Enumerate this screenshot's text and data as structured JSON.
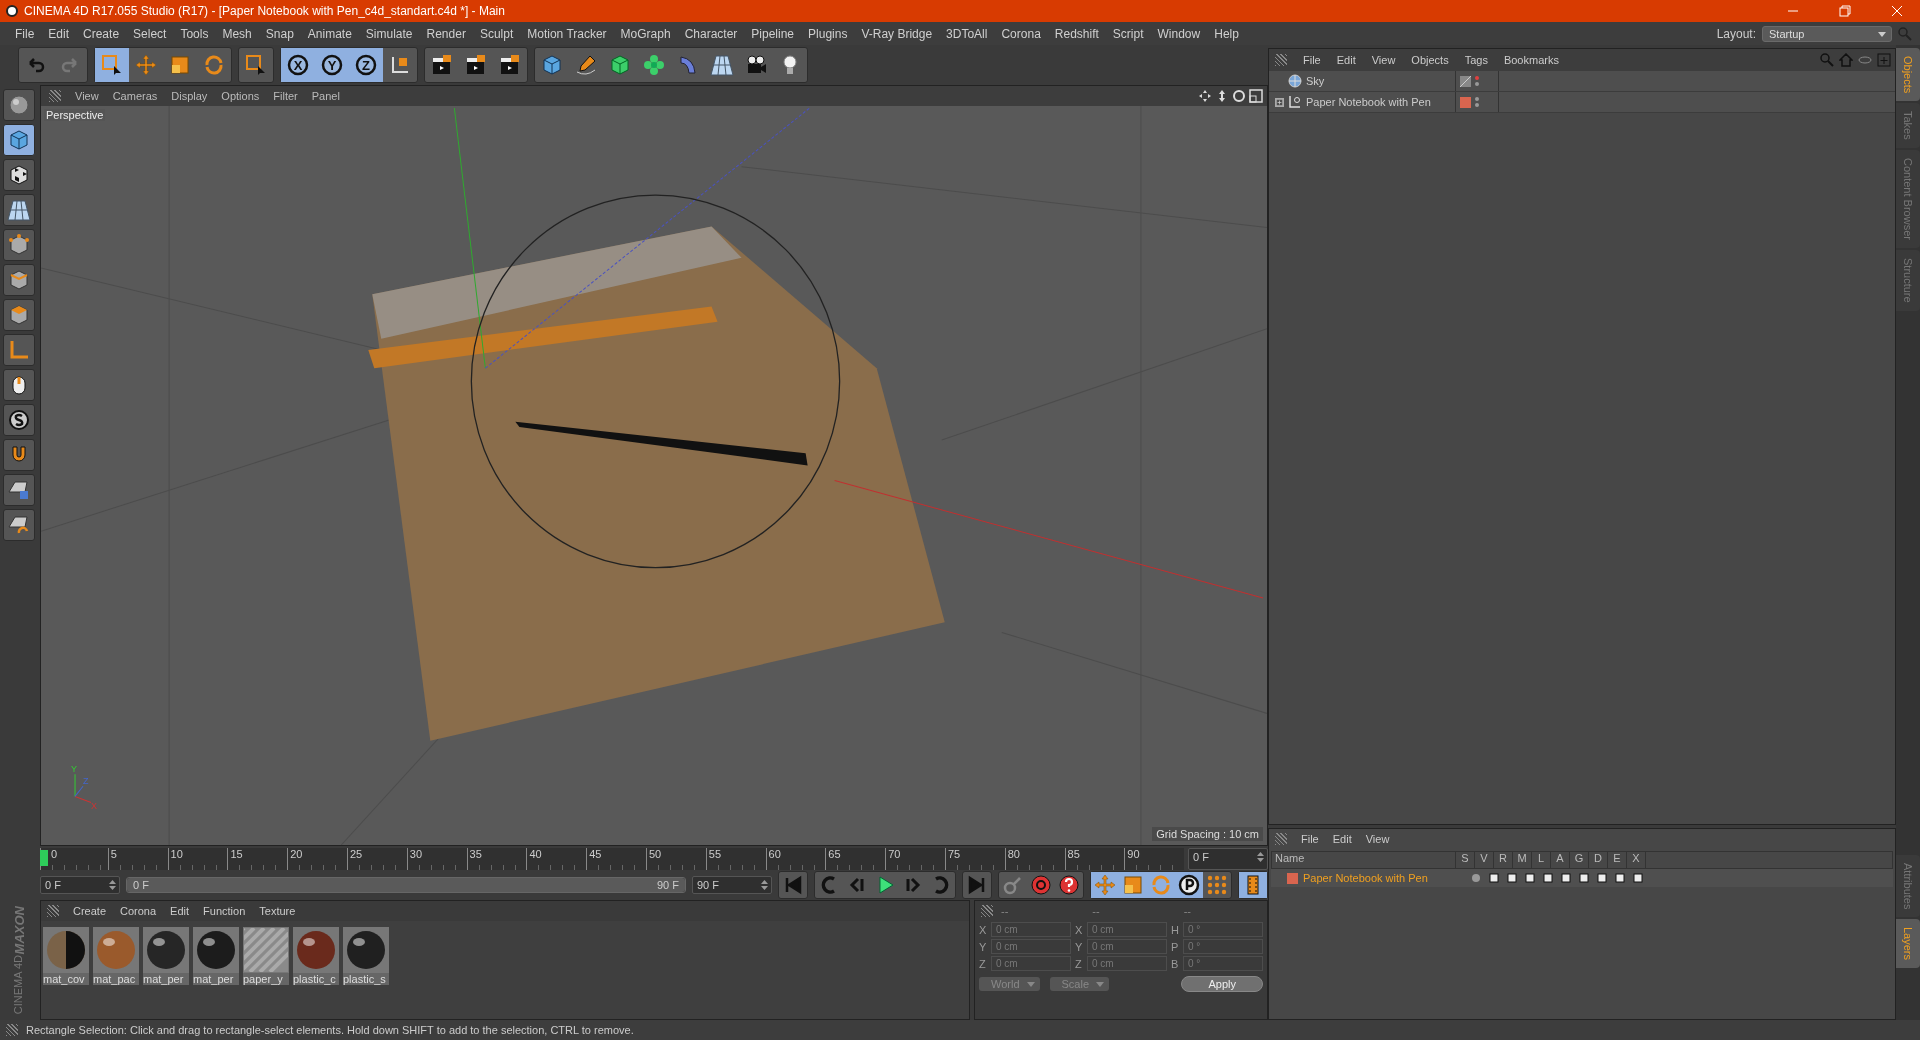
{
  "window": {
    "title": "CINEMA 4D R17.055 Studio (R17) - [Paper Notebook with Pen_c4d_standart.c4d *] - Main"
  },
  "menu": [
    "File",
    "Edit",
    "Create",
    "Select",
    "Tools",
    "Mesh",
    "Snap",
    "Animate",
    "Simulate",
    "Render",
    "Sculpt",
    "Motion Tracker",
    "MoGraph",
    "Character",
    "Pipeline",
    "Plugins",
    "V-Ray Bridge",
    "3DToAll",
    "Corona",
    "Redshift",
    "Script",
    "Window",
    "Help"
  ],
  "layout": {
    "label": "Layout:",
    "value": "Startup"
  },
  "toolbar": [
    {
      "kind": "undo",
      "selected": false
    },
    {
      "kind": "redo",
      "selected": false
    },
    {
      "kind": "select",
      "selected": true
    },
    {
      "kind": "move",
      "selected": false
    },
    {
      "kind": "scale",
      "selected": false
    },
    {
      "kind": "rotate",
      "selected": false
    },
    {
      "kind": "select",
      "selected": false
    },
    {
      "kind": "axis",
      "label": "X",
      "selected": true
    },
    {
      "kind": "axis",
      "label": "Y",
      "selected": true
    },
    {
      "kind": "axis",
      "label": "Z",
      "selected": true
    },
    {
      "kind": "coords",
      "selected": false
    },
    {
      "kind": "clapper",
      "selected": false
    },
    {
      "kind": "clapper",
      "selected": false
    },
    {
      "kind": "clapper",
      "selected": false
    },
    {
      "kind": "cube",
      "selected": false
    },
    {
      "kind": "pen",
      "selected": false
    },
    {
      "kind": "greencube",
      "selected": false
    },
    {
      "kind": "flower",
      "selected": false
    },
    {
      "kind": "bend",
      "selected": false
    },
    {
      "kind": "floor",
      "selected": false
    },
    {
      "kind": "camera",
      "selected": false
    },
    {
      "kind": "bulb",
      "selected": false
    }
  ],
  "left_tools": [
    {
      "kind": "sphere",
      "selected": false
    },
    {
      "kind": "cube",
      "selected": true
    },
    {
      "kind": "checker",
      "selected": false
    },
    {
      "kind": "floor",
      "selected": false
    },
    {
      "kind": "points",
      "selected": false
    },
    {
      "kind": "edges",
      "selected": false
    },
    {
      "kind": "faces",
      "selected": false
    },
    {
      "kind": "corner",
      "selected": false
    },
    {
      "kind": "mouse",
      "selected": false
    },
    {
      "kind": "scircle",
      "selected": false
    },
    {
      "kind": "magnet",
      "selected": false
    },
    {
      "kind": "gridlock",
      "selected": false
    },
    {
      "kind": "gridturn",
      "selected": false
    }
  ],
  "viewport": {
    "menu": [
      "View",
      "Cameras",
      "Display",
      "Options",
      "Filter",
      "Panel"
    ],
    "camera": "Perspective",
    "grid_spacing": "Grid Spacing : 10 cm",
    "gizmo_labels": [
      "Y",
      "Z",
      "X"
    ]
  },
  "object_manager": {
    "menu": [
      "File",
      "Edit",
      "View",
      "Objects",
      "Tags",
      "Bookmarks"
    ],
    "objects": [
      {
        "name": "Sky",
        "expandable": false
      },
      {
        "name": "Paper Notebook with Pen",
        "expandable": true,
        "color": "#d9654f"
      }
    ]
  },
  "side_tabs_top": [
    {
      "label": "Objects",
      "selected": true
    },
    {
      "label": "Takes",
      "selected": false
    },
    {
      "label": "Content Browser",
      "selected": false
    },
    {
      "label": "Structure",
      "selected": false
    }
  ],
  "layer_manager": {
    "menu": [
      "File",
      "Edit",
      "View"
    ],
    "columns": [
      "Name",
      "S",
      "V",
      "R",
      "M",
      "L",
      "A",
      "G",
      "D",
      "E",
      "X"
    ],
    "layers": [
      {
        "name": "Paper Notebook with Pen",
        "color": "#d9654f"
      }
    ]
  },
  "side_tabs_bottom": [
    {
      "label": "Attributes",
      "selected": false
    },
    {
      "label": "Layers",
      "selected": true
    }
  ],
  "timeline": {
    "ticks": [
      "0",
      "5",
      "10",
      "15",
      "20",
      "25",
      "30",
      "35",
      "40",
      "45",
      "50",
      "55",
      "60",
      "65",
      "70",
      "75",
      "80",
      "85",
      "90"
    ],
    "current_frame": "0 F",
    "start": "0 F",
    "range": {
      "start": "0 F",
      "end": "90 F",
      "level": 1
    },
    "end": "90 F"
  },
  "transport": [
    {
      "kind": "first",
      "selected": false
    },
    {
      "kind": "prevkey",
      "selected": false
    },
    {
      "kind": "prev",
      "selected": false
    },
    {
      "kind": "play",
      "selected": false
    },
    {
      "kind": "next",
      "selected": false
    },
    {
      "kind": "nextkey",
      "selected": false
    },
    {
      "kind": "last",
      "selected": false
    },
    {
      "kind": "keylock",
      "selected": false
    },
    {
      "kind": "record",
      "selected": false
    },
    {
      "kind": "help",
      "selected": false
    },
    {
      "kind": "move",
      "selected": true
    },
    {
      "kind": "scale",
      "selected": true
    },
    {
      "kind": "rotate",
      "selected": true
    },
    {
      "kind": "pcircle",
      "selected": true
    },
    {
      "kind": "dots",
      "selected": false
    },
    {
      "kind": "film",
      "selected": true
    }
  ],
  "material_manager": {
    "menu": [
      "Create",
      "Corona",
      "Edit",
      "Function",
      "Texture"
    ],
    "materials": [
      {
        "name": "mat_cov",
        "kind": "split",
        "color": "#7a6248"
      },
      {
        "name": "mat_pac",
        "kind": "sphere",
        "color": "#9a5a2c"
      },
      {
        "name": "mat_per",
        "kind": "sphere",
        "color": "#262626"
      },
      {
        "name": "mat_per",
        "kind": "sphere",
        "color": "#1c1c1c"
      },
      {
        "name": "paper_y",
        "kind": "stripes",
        "color": "#8a8a8a"
      },
      {
        "name": "plastic_c",
        "kind": "sphere",
        "color": "#6a2a1c"
      },
      {
        "name": "plastic_s",
        "kind": "sphere",
        "color": "#202020"
      }
    ]
  },
  "coordinates": {
    "headers": [
      "--",
      "--",
      "--"
    ],
    "rows": [
      {
        "pos_axis": "X",
        "pos": "0 cm",
        "size_axis": "X",
        "size": "0 cm",
        "rot_axis": "H",
        "rot": "0 °"
      },
      {
        "pos_axis": "Y",
        "pos": "0 cm",
        "size_axis": "Y",
        "size": "0 cm",
        "rot_axis": "P",
        "rot": "0 °"
      },
      {
        "pos_axis": "Z",
        "pos": "0 cm",
        "size_axis": "Z",
        "size": "0 cm",
        "rot_axis": "B",
        "rot": "0 °"
      }
    ],
    "mode": "World",
    "scale": "Scale",
    "apply": "Apply"
  },
  "logo": [
    "MAXON",
    "CINEMA 4D"
  ],
  "status_bar": "Rectangle Selection: Click and drag to rectangle-select elements. Hold down SHIFT to add to the selection, CTRL to remove."
}
